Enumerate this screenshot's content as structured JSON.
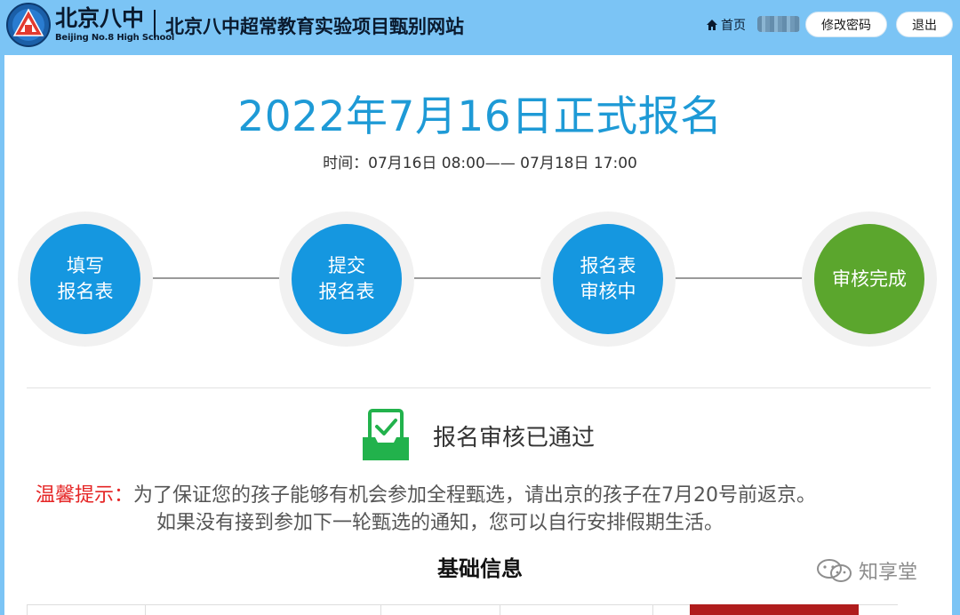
{
  "header": {
    "logo_cn": "北京八中",
    "logo_en": "Beijing No.8 High School",
    "site_title": "北京八中超常教育实验项目甄别网站",
    "home_label": "首页",
    "change_password_label": "修改密码",
    "logout_label": "退出"
  },
  "main": {
    "title": "2022年7月16日正式报名",
    "time_label": "时间：",
    "time_range": "07月16日 08:00—— 07月18日 17:00"
  },
  "steps": [
    {
      "line1": "填写",
      "line2": "报名表",
      "color": "#1597e0"
    },
    {
      "line1": "提交",
      "line2": "报名表",
      "color": "#1597e0"
    },
    {
      "line1": "报名表",
      "line2": "审核中",
      "color": "#1597e0"
    },
    {
      "line1": "审核完成",
      "line2": "",
      "color": "#5ba62d"
    }
  ],
  "status": {
    "icon": "check-tray-icon",
    "text": "报名审核已通过"
  },
  "tip": {
    "label": "温馨提示：",
    "line1": "为了保证您的孩子能够有机会参加全程甄选，请出京的孩子在7月20号前返京。",
    "line2": "如果没有接到参加下一轮甄选的通知，您可以自行安排假期生活。"
  },
  "section_title": "基础信息",
  "watermark": {
    "icon": "wechat-icon",
    "text": "知享堂"
  },
  "colors": {
    "header_bg": "#7bc4f5",
    "accent_blue": "#1e9ad6",
    "step_blue": "#1597e0",
    "step_green": "#5ba62d",
    "tip_red": "#e52525"
  }
}
